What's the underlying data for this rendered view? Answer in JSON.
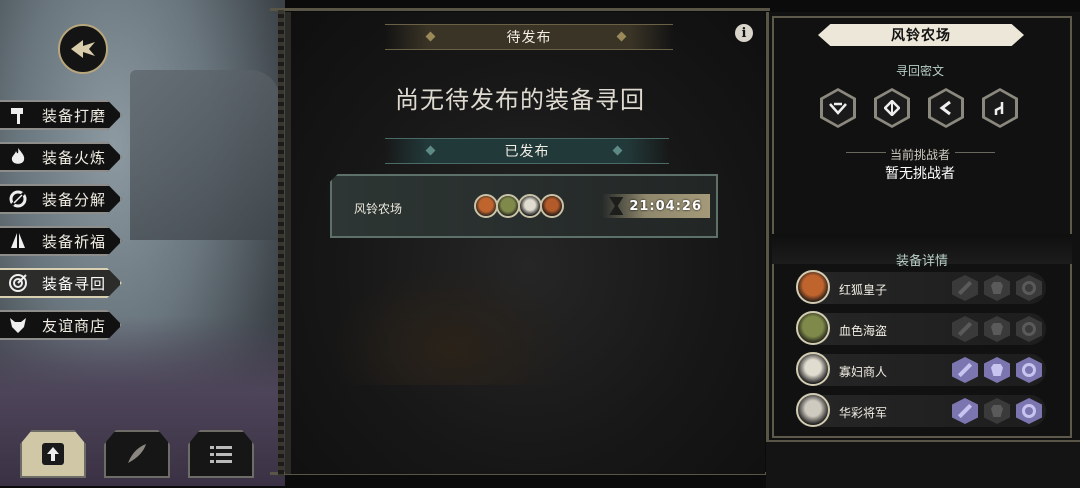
{
  "left_menu": {
    "items": [
      {
        "label": "装备打磨",
        "icon": "hammer-icon",
        "active": false
      },
      {
        "label": "装备火炼",
        "icon": "flame-icon",
        "active": false
      },
      {
        "label": "装备分解",
        "icon": "broken-circle-icon",
        "active": false
      },
      {
        "label": "装备祈福",
        "icon": "praying-hands-icon",
        "active": false
      },
      {
        "label": "装备寻回",
        "icon": "target-icon",
        "active": true
      },
      {
        "label": "友谊商店",
        "icon": "fox-head-icon",
        "active": false
      }
    ],
    "bottom_buttons": [
      {
        "icon": "upload-icon",
        "active": true
      },
      {
        "icon": "feather-icon",
        "active": false
      },
      {
        "icon": "list-icon",
        "active": false
      }
    ]
  },
  "center": {
    "pending_title": "待发布",
    "pending_empty": "尚无待发布的装备寻回",
    "published_title": "已发布",
    "published_entry": {
      "name": "风铃农场",
      "timer": "21:04:26"
    }
  },
  "right": {
    "location_title": "风铃农场",
    "cipher_label": "寻回密文",
    "current_challenger_label": "当前挑战者",
    "current_challenger_value": "暂无挑战者",
    "equipment_label": "装备详情",
    "characters": [
      {
        "name": "红狐皇子",
        "slots": [
          false,
          false,
          false
        ]
      },
      {
        "name": "血色海盗",
        "slots": [
          false,
          false,
          false
        ]
      },
      {
        "name": "寡妇商人",
        "slots": [
          true,
          true,
          true
        ]
      },
      {
        "name": "华彩将军",
        "slots": [
          true,
          false,
          true
        ]
      }
    ]
  },
  "colors": {
    "accent_gold": "#b8a77c",
    "teal_label": "#b8cfc6",
    "equip_active": "#7c76b0"
  }
}
